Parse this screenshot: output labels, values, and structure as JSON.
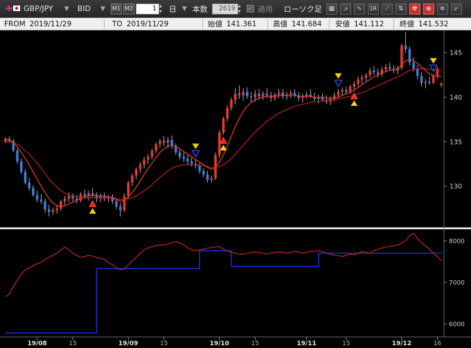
{
  "toolbar": {
    "pair": "GBP/JPY",
    "side": "BID",
    "m1_label": "M1",
    "m2_label": "M2",
    "period_value": "1",
    "period_unit": "日",
    "count_label": "本数",
    "count_value": "2619",
    "apply_label": "適用",
    "chart_type": "ローソク足",
    "icon_1r": "1R"
  },
  "info": {
    "from_label": "FROM",
    "from_value": "2019/11/29",
    "to_label": "TO",
    "to_value": "2019/11/29",
    "open_label": "始値",
    "open_value": "141.361",
    "high_label": "高値",
    "high_value": "141.684",
    "low_label": "安値",
    "low_value": "141.112",
    "close_label": "終値",
    "close_value": "141.532"
  },
  "colors": {
    "up": "#e8392e",
    "down": "#3b7fd8",
    "ma_fast": "#e33a2f",
    "ma_slow": "#b01e1e",
    "sub_line": "#b3261e",
    "sub_step": "#1a2ecf",
    "signal_buy": "#ff1f1f",
    "signal_sell": "#2a4bd7",
    "signal_marker": "#f2d200",
    "separator": "#ffffff"
  },
  "chart_data": {
    "type": "candlestick",
    "main_y_ticks": [
      "130",
      "135",
      "140",
      "145"
    ],
    "main_ylim": [
      125.5,
      147.5
    ],
    "sub_y_ticks": [
      "6000",
      "7000",
      "8000"
    ],
    "sub_ylim": [
      5700,
      8200
    ],
    "x_ticks": [
      "19/08",
      "15",
      "19/09",
      "15",
      "19/10",
      "15",
      "19/11",
      "15",
      "19/12",
      "16"
    ],
    "x_ticks_bold": [
      true,
      false,
      true,
      false,
      true,
      false,
      true,
      false,
      true,
      false
    ],
    "x_tick_index": [
      8,
      17,
      31,
      40,
      54,
      63,
      76,
      86,
      100,
      109
    ],
    "candles": [
      [
        135.0,
        135.5,
        134.8,
        135.3
      ],
      [
        135.3,
        135.6,
        134.9,
        135.1
      ],
      [
        135.1,
        135.3,
        133.8,
        134.0
      ],
      [
        134.0,
        134.2,
        132.5,
        132.8
      ],
      [
        132.8,
        133.1,
        131.4,
        131.6
      ],
      [
        131.6,
        131.9,
        130.2,
        130.4
      ],
      [
        130.4,
        130.9,
        129.5,
        129.8
      ],
      [
        129.8,
        130.1,
        128.8,
        129.0
      ],
      [
        129.0,
        129.5,
        128.2,
        128.5
      ],
      [
        128.5,
        129.1,
        128.0,
        128.3
      ],
      [
        128.3,
        128.6,
        127.0,
        127.4
      ],
      [
        127.4,
        127.9,
        126.6,
        127.1
      ],
      [
        127.1,
        127.6,
        126.8,
        127.3
      ],
      [
        127.3,
        127.9,
        126.9,
        127.5
      ],
      [
        127.5,
        128.5,
        127.2,
        128.3
      ],
      [
        128.3,
        128.9,
        127.9,
        128.6
      ],
      [
        128.6,
        129.3,
        128.2,
        128.9
      ],
      [
        128.9,
        129.2,
        128.3,
        128.6
      ],
      [
        128.6,
        129.0,
        128.1,
        128.4
      ],
      [
        128.4,
        129.3,
        128.2,
        129.1
      ],
      [
        129.1,
        129.6,
        128.6,
        128.9
      ],
      [
        128.9,
        129.5,
        128.4,
        129.2
      ],
      [
        129.2,
        129.8,
        128.7,
        129.0
      ],
      [
        129.0,
        129.3,
        128.2,
        128.6
      ],
      [
        128.6,
        129.2,
        128.2,
        128.9
      ],
      [
        128.9,
        129.3,
        128.3,
        128.6
      ],
      [
        128.6,
        129.0,
        128.2,
        128.8
      ],
      [
        128.8,
        129.1,
        128.0,
        128.3
      ],
      [
        128.3,
        128.6,
        127.4,
        127.7
      ],
      [
        127.7,
        128.1,
        126.6,
        127.3
      ],
      [
        127.3,
        129.2,
        127.1,
        128.9
      ],
      [
        128.9,
        130.6,
        128.6,
        130.4
      ],
      [
        130.4,
        131.4,
        130.0,
        131.2
      ],
      [
        131.2,
        132.1,
        130.8,
        131.9
      ],
      [
        131.9,
        132.7,
        131.5,
        132.4
      ],
      [
        132.4,
        133.3,
        132.0,
        133.0
      ],
      [
        133.0,
        133.6,
        132.5,
        133.3
      ],
      [
        133.3,
        134.2,
        133.0,
        134.0
      ],
      [
        134.0,
        134.9,
        133.7,
        134.7
      ],
      [
        134.7,
        135.3,
        134.3,
        135.1
      ],
      [
        135.1,
        135.6,
        134.5,
        134.9
      ],
      [
        134.9,
        135.5,
        134.3,
        135.2
      ],
      [
        135.2,
        135.7,
        134.2,
        134.5
      ],
      [
        134.5,
        134.8,
        133.5,
        133.8
      ],
      [
        133.8,
        134.1,
        133.0,
        133.3
      ],
      [
        133.3,
        133.8,
        132.7,
        133.1
      ],
      [
        133.1,
        133.5,
        132.4,
        132.8
      ],
      [
        132.8,
        133.2,
        132.2,
        132.5
      ],
      [
        132.5,
        133.0,
        132.0,
        132.3
      ],
      [
        132.3,
        132.6,
        131.4,
        131.7
      ],
      [
        131.7,
        132.0,
        131.0,
        131.3
      ],
      [
        131.3,
        131.7,
        130.4,
        130.7
      ],
      [
        130.7,
        131.2,
        130.4,
        130.9
      ],
      [
        130.9,
        133.8,
        130.7,
        133.5
      ],
      [
        133.5,
        136.3,
        133.2,
        136.0
      ],
      [
        136.0,
        137.8,
        135.8,
        137.6
      ],
      [
        137.6,
        139.1,
        137.3,
        138.8
      ],
      [
        138.8,
        140.0,
        138.5,
        139.7
      ],
      [
        139.7,
        141.0,
        139.2,
        140.4
      ],
      [
        140.4,
        141.3,
        139.8,
        140.2
      ],
      [
        140.2,
        141.0,
        139.6,
        140.6
      ],
      [
        140.6,
        141.1,
        139.8,
        140.1
      ],
      [
        140.1,
        140.6,
        139.4,
        140.0
      ],
      [
        140.0,
        140.8,
        139.5,
        140.4
      ],
      [
        140.4,
        140.9,
        139.7,
        140.1
      ],
      [
        140.1,
        140.7,
        139.7,
        140.4
      ],
      [
        140.4,
        141.0,
        139.9,
        140.2
      ],
      [
        140.2,
        140.6,
        139.5,
        139.9
      ],
      [
        139.9,
        140.5,
        139.6,
        140.3
      ],
      [
        140.3,
        140.9,
        139.9,
        140.5
      ],
      [
        140.5,
        140.9,
        139.8,
        140.1
      ],
      [
        140.1,
        140.6,
        139.7,
        140.3
      ],
      [
        140.3,
        140.8,
        139.9,
        140.5
      ],
      [
        140.5,
        140.9,
        140.0,
        140.2
      ],
      [
        140.2,
        140.6,
        139.6,
        139.9
      ],
      [
        139.9,
        140.4,
        139.4,
        140.1
      ],
      [
        140.1,
        140.6,
        139.8,
        140.3
      ],
      [
        140.3,
        140.9,
        139.9,
        140.0
      ],
      [
        140.0,
        140.5,
        139.6,
        139.8
      ],
      [
        139.8,
        140.3,
        139.3,
        140.0
      ],
      [
        140.0,
        140.4,
        139.5,
        139.7
      ],
      [
        139.7,
        140.2,
        139.2,
        139.5
      ],
      [
        139.5,
        140.1,
        139.1,
        139.8
      ],
      [
        139.8,
        140.5,
        139.5,
        140.2
      ],
      [
        140.2,
        140.9,
        139.9,
        140.6
      ],
      [
        140.6,
        141.1,
        140.2,
        140.8
      ],
      [
        140.8,
        141.2,
        140.3,
        140.6
      ],
      [
        140.6,
        141.4,
        140.4,
        141.2
      ],
      [
        141.2,
        141.8,
        140.8,
        141.5
      ],
      [
        141.5,
        142.3,
        141.2,
        142.0
      ],
      [
        142.0,
        142.5,
        141.5,
        142.2
      ],
      [
        142.2,
        142.7,
        141.8,
        142.5
      ],
      [
        142.5,
        143.3,
        142.2,
        143.0
      ],
      [
        143.0,
        143.5,
        142.5,
        142.8
      ],
      [
        142.8,
        143.2,
        142.2,
        142.6
      ],
      [
        142.6,
        143.4,
        142.3,
        143.1
      ],
      [
        143.1,
        143.7,
        142.8,
        143.4
      ],
      [
        143.4,
        143.9,
        143.0,
        143.2
      ],
      [
        143.2,
        143.6,
        142.7,
        143.0
      ],
      [
        143.0,
        143.5,
        142.6,
        143.3
      ],
      [
        143.3,
        146.0,
        143.1,
        145.8
      ],
      [
        145.8,
        147.3,
        145.0,
        145.4
      ],
      [
        145.4,
        145.7,
        143.6,
        143.9
      ],
      [
        143.9,
        144.5,
        142.9,
        143.2
      ],
      [
        143.2,
        143.6,
        142.0,
        142.4
      ],
      [
        142.4,
        142.8,
        141.2,
        141.6
      ],
      [
        141.6,
        142.0,
        141.0,
        141.7
      ],
      [
        141.7,
        142.3,
        141.4,
        141.6
      ],
      [
        141.6,
        142.6,
        141.5,
        142.4
      ],
      [
        142.4,
        143.4,
        142.1,
        143.2
      ],
      [
        141.361,
        141.684,
        141.112,
        141.532
      ]
    ],
    "ma_fast": [
      135.3,
      135.2,
      134.9,
      134.4,
      133.8,
      133.1,
      132.4,
      131.6,
      130.8,
      130.0,
      129.3,
      128.6,
      128.1,
      127.8,
      127.7,
      127.8,
      128.0,
      128.2,
      128.4,
      128.6,
      128.8,
      128.9,
      129.0,
      129.0,
      128.9,
      128.9,
      128.8,
      128.7,
      128.5,
      128.3,
      128.4,
      128.8,
      129.3,
      129.9,
      130.6,
      131.3,
      132.0,
      132.6,
      133.2,
      133.8,
      134.2,
      134.5,
      134.6,
      134.5,
      134.2,
      133.9,
      133.6,
      133.3,
      133.0,
      132.7,
      132.4,
      132.1,
      131.9,
      132.1,
      132.7,
      133.5,
      134.5,
      135.6,
      136.7,
      137.6,
      138.4,
      139.0,
      139.4,
      139.7,
      139.9,
      140.0,
      140.1,
      140.1,
      140.1,
      140.2,
      140.2,
      140.2,
      140.2,
      140.2,
      140.1,
      140.1,
      140.1,
      140.1,
      140.0,
      140.0,
      140.0,
      139.9,
      139.9,
      139.9,
      140.0,
      140.2,
      140.4,
      140.5,
      140.8,
      141.1,
      141.4,
      141.7,
      142.0,
      142.3,
      142.5,
      142.7,
      142.9,
      143.0,
      143.1,
      143.2,
      143.6,
      144.1,
      144.2,
      144.1,
      143.8,
      143.4,
      143.0,
      142.6,
      142.4,
      142.4,
      142.3
    ],
    "ma_slow": [
      135.0,
      135.0,
      134.9,
      134.7,
      134.4,
      134.0,
      133.6,
      133.1,
      132.6,
      132.0,
      131.4,
      130.8,
      130.3,
      129.9,
      129.5,
      129.2,
      129.0,
      128.9,
      128.8,
      128.7,
      128.7,
      128.7,
      128.7,
      128.7,
      128.7,
      128.7,
      128.7,
      128.7,
      128.6,
      128.5,
      128.5,
      128.6,
      128.7,
      128.9,
      129.2,
      129.5,
      129.8,
      130.2,
      130.6,
      131.0,
      131.4,
      131.7,
      132.0,
      132.2,
      132.3,
      132.4,
      132.4,
      132.4,
      132.4,
      132.3,
      132.3,
      132.2,
      132.1,
      132.1,
      132.2,
      132.4,
      132.7,
      133.1,
      133.6,
      134.1,
      134.6,
      135.1,
      135.6,
      136.1,
      136.5,
      136.9,
      137.3,
      137.6,
      137.9,
      138.2,
      138.4,
      138.6,
      138.8,
      139.0,
      139.1,
      139.2,
      139.3,
      139.4,
      139.5,
      139.5,
      139.6,
      139.6,
      139.7,
      139.7,
      139.8,
      139.9,
      140.0,
      140.1,
      140.2,
      140.4,
      140.5,
      140.7,
      140.9,
      141.1,
      141.3,
      141.5,
      141.7,
      141.9,
      142.1,
      142.3,
      142.5,
      142.8,
      143.0,
      143.1,
      143.2,
      143.2,
      143.2,
      143.1,
      143.1,
      143.1,
      143.0
    ],
    "signals": [
      {
        "i": 22,
        "type": "buy"
      },
      {
        "i": 48,
        "type": "sell"
      },
      {
        "i": 55,
        "type": "buy"
      },
      {
        "i": 84,
        "type": "sell"
      },
      {
        "i": 88,
        "type": "buy"
      },
      {
        "i": 108,
        "type": "sell"
      }
    ],
    "sub_line": [
      6650,
      6720,
      6900,
      7050,
      7200,
      7300,
      7350,
      7400,
      7450,
      7480,
      7550,
      7600,
      7650,
      7700,
      7780,
      7850,
      7780,
      7700,
      7650,
      7600,
      7620,
      7650,
      7630,
      7600,
      7580,
      7550,
      7480,
      7420,
      7350,
      7300,
      7320,
      7420,
      7520,
      7600,
      7700,
      7780,
      7830,
      7860,
      7880,
      7900,
      7900,
      7920,
      7950,
      7980,
      7950,
      7900,
      7830,
      7780,
      7760,
      7780,
      7800,
      7820,
      7840,
      7850,
      7860,
      7800,
      7750,
      7720,
      7700,
      7680,
      7680,
      7700,
      7720,
      7730,
      7720,
      7700,
      7680,
      7700,
      7720,
      7730,
      7720,
      7700,
      7720,
      7740,
      7730,
      7700,
      7720,
      7740,
      7750,
      7760,
      7740,
      7700,
      7680,
      7650,
      7640,
      7620,
      7650,
      7680,
      7660,
      7700,
      7740,
      7720,
      7700,
      7760,
      7800,
      7820,
      7850,
      7860,
      7880,
      7900,
      7950,
      8000,
      8120,
      8180,
      8050,
      7950,
      7880,
      7800,
      7700,
      7620,
      7520
    ],
    "sub_step": [
      [
        0,
        5780
      ],
      [
        23,
        5780
      ],
      [
        23,
        7330
      ],
      [
        49,
        7330
      ],
      [
        49,
        7760
      ],
      [
        57,
        7760
      ],
      [
        57,
        7380
      ],
      [
        79,
        7380
      ],
      [
        79,
        7700
      ],
      [
        110,
        7700
      ]
    ]
  }
}
